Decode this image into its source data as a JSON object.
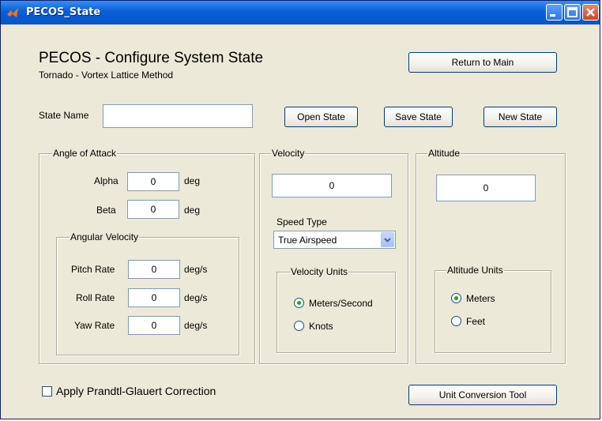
{
  "window": {
    "title": "PECOS_State"
  },
  "header": {
    "title": "PECOS - Configure System State",
    "subtitle": "Tornado - Vortex Lattice Method",
    "return_button": "Return to Main"
  },
  "state": {
    "label": "State Name",
    "value": "",
    "open_button": "Open State",
    "save_button": "Save State",
    "new_button": "New State"
  },
  "angle_of_attack": {
    "title": "Angle of Attack",
    "alpha": {
      "label": "Alpha",
      "value": "0",
      "unit": "deg"
    },
    "beta": {
      "label": "Beta",
      "value": "0",
      "unit": "deg"
    },
    "angular_velocity": {
      "title": "Angular Velocity",
      "pitch": {
        "label": "Pitch Rate",
        "value": "0",
        "unit": "deg/s"
      },
      "roll": {
        "label": "Roll Rate",
        "value": "0",
        "unit": "deg/s"
      },
      "yaw": {
        "label": "Yaw Rate",
        "value": "0",
        "unit": "deg/s"
      }
    }
  },
  "velocity": {
    "title": "Velocity",
    "value": "0",
    "speed_type_label": "Speed Type",
    "speed_type_selected": "True Airspeed",
    "units": {
      "title": "Velocity Units",
      "options": [
        "Meters/Second",
        "Knots"
      ],
      "selected": "Meters/Second"
    }
  },
  "altitude": {
    "title": "Altitude",
    "value": "0",
    "units": {
      "title": "Altitude Units",
      "options": [
        "Meters",
        "Feet"
      ],
      "selected": "Meters"
    }
  },
  "footer": {
    "prandtl_label": "Apply Prandtl-Glauert Correction",
    "prandtl_checked": false,
    "unit_conversion_button": "Unit Conversion Tool"
  },
  "colors": {
    "titlebar": "#0a5fd8",
    "background": "#ece9d8",
    "radio_dot": "#21a121"
  }
}
